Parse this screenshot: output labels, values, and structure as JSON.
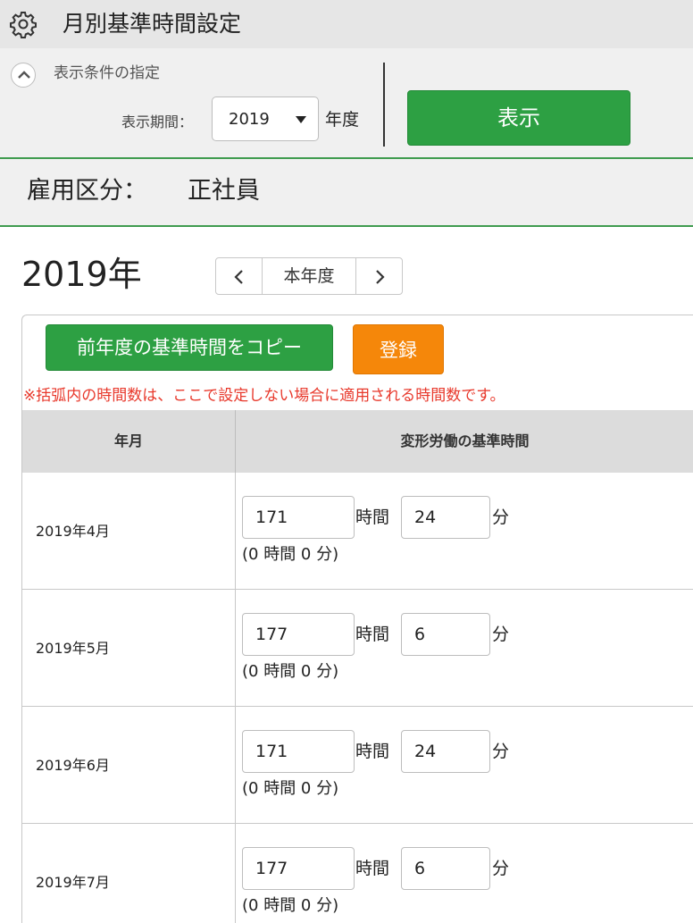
{
  "page": {
    "title": "月別基準時間設定"
  },
  "condition": {
    "section_title": "表示条件の指定",
    "period_label": "表示期間：",
    "year_value": "2019",
    "year_unit": "年度",
    "show_button": "表示"
  },
  "employment": {
    "label": "雇用区分：",
    "value": "正社員"
  },
  "year_nav": {
    "year_title": "2019年",
    "current_label": "本年度"
  },
  "actions": {
    "copy_button": "前年度の基準時間をコピー",
    "register_button": "登録"
  },
  "note": "※括弧内の時間数は、ここで設定しない場合に適用される時間数です。",
  "table": {
    "headers": {
      "year_month": "年月",
      "standard_time": "変形労働の基準時間"
    },
    "hours_unit": "時間",
    "minutes_unit": "分",
    "rows": [
      {
        "month": "2019年4月",
        "hours": "171",
        "minutes": "24",
        "default": "(0 時間 0 分)"
      },
      {
        "month": "2019年5月",
        "hours": "177",
        "minutes": "6",
        "default": "(0 時間 0 分)"
      },
      {
        "month": "2019年6月",
        "hours": "171",
        "minutes": "24",
        "default": "(0 時間 0 分)"
      },
      {
        "month": "2019年7月",
        "hours": "177",
        "minutes": "6",
        "default": "(0 時間 0 分)"
      }
    ]
  },
  "colors": {
    "accent_green": "#2da043",
    "accent_orange": "#f5870a",
    "note_red": "#e8382b"
  }
}
